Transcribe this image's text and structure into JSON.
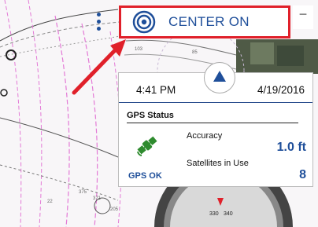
{
  "toolbar": {
    "center_label": "CENTER ON",
    "minimize_glyph": "−",
    "menu_icon": "more-vertical-icon",
    "center_icon": "target-crosshair-icon"
  },
  "gps_panel": {
    "time": "4:41 PM",
    "date": "4/19/2016",
    "section_title": "GPS Status",
    "status": "GPS OK",
    "accuracy_label": "Accuracy",
    "accuracy_value": "1.0 ft",
    "satellites_label": "Satellites in Use",
    "satellites_value": "8",
    "status_icon": "satellite-icon",
    "nav_icon": "north-up-arrow-icon"
  },
  "compass": {
    "labels": [
      "330",
      "340"
    ]
  },
  "chart_soundings": [
    "103",
    "85",
    "375",
    "371",
    "22",
    "205"
  ],
  "colors": {
    "accent": "#1f4f9a",
    "highlight": "#e0202a",
    "gps_ok_green": "#2e8b2e"
  }
}
